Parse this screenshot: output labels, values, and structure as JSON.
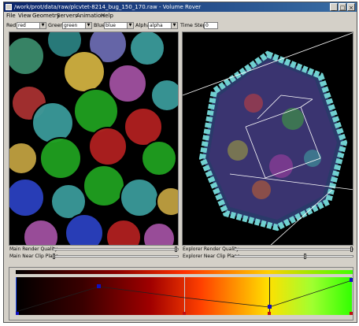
{
  "window": {
    "title": "/work/prot/data/raw/plcvtet-8214_bug_150_170.raw - Volume Rover",
    "minimize": "_",
    "maximize": "□",
    "close": "×"
  },
  "menu": [
    "File",
    "View",
    "Geometry",
    "Servers",
    "Animation",
    "Help"
  ],
  "toolbar": {
    "red_label": "Red",
    "red_value": "red",
    "green_label": "Green",
    "green_value": "green",
    "blue_label": "Blue",
    "blue_value": "blue",
    "alpha_label": "Alpha",
    "alpha_value": "alpha",
    "timestep_label": "Time Step",
    "timestep_value": "0"
  },
  "bottom": {
    "main_render_quality": "Main Render Quality",
    "explorer_render_quality": "Explorer Render Quality",
    "main_near_clip": "Main Near Clip Plane",
    "explorer_near_clip": "Explorer Near Clip Plane"
  },
  "sliders": {
    "main_render_quality": 0.99,
    "explorer_render_quality": 0.99,
    "main_near_clip": 0.0,
    "explorer_near_clip": 0.6
  },
  "colors": {
    "accent": "#0a246a",
    "panel": "#d4d0c8"
  },
  "icons": {
    "app": "volume-rover-icon",
    "close": "close-icon",
    "maximize": "maximize-icon",
    "minimize": "minimize-icon"
  }
}
